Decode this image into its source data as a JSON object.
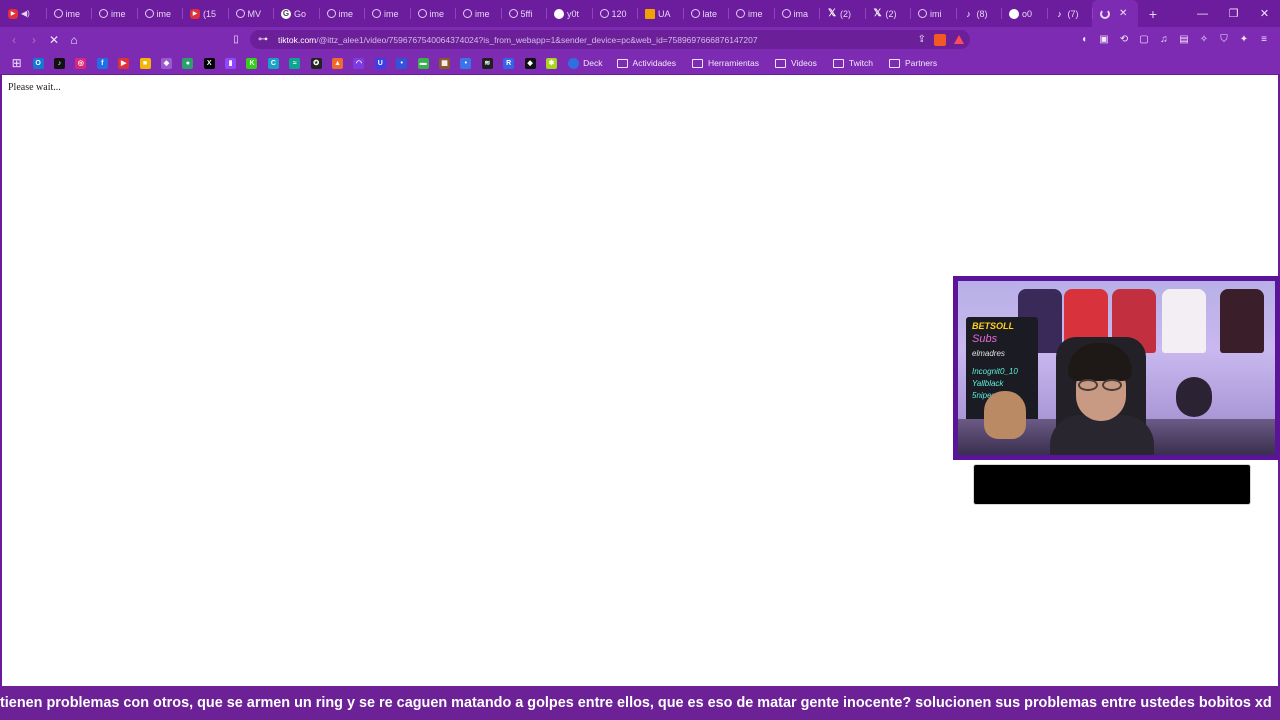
{
  "colors": {
    "frame": "#6c1d9e",
    "toolbar": "#7e2bb3",
    "omnibox": "#6b1f99",
    "content_bg": "#ffffff",
    "subtitle_bg": "#6d2196"
  },
  "tabs": [
    {
      "icon": "youtube-icon",
      "glyph": "▶",
      "style": "yt",
      "title": "",
      "audio": true
    },
    {
      "icon": "globe-icon",
      "glyph": "",
      "style": "globe",
      "title": "ime"
    },
    {
      "icon": "globe-icon",
      "glyph": "",
      "style": "globe",
      "title": "ime"
    },
    {
      "icon": "globe-icon",
      "glyph": "",
      "style": "globe",
      "title": "ime"
    },
    {
      "icon": "youtube-icon",
      "glyph": "▶",
      "style": "yt",
      "title": "(15"
    },
    {
      "icon": "globe-icon",
      "glyph": "",
      "style": "globe",
      "title": "MV"
    },
    {
      "icon": "google-icon",
      "glyph": "G",
      "style": "g",
      "title": "Go"
    },
    {
      "icon": "globe-icon",
      "glyph": "",
      "style": "globe",
      "title": "ime"
    },
    {
      "icon": "globe-icon",
      "glyph": "",
      "style": "globe",
      "title": "ime"
    },
    {
      "icon": "globe-icon",
      "glyph": "",
      "style": "globe",
      "title": "ime"
    },
    {
      "icon": "globe-icon",
      "glyph": "",
      "style": "globe",
      "title": "ime"
    },
    {
      "icon": "globe-icon",
      "glyph": "",
      "style": "globe",
      "title": "5ffi"
    },
    {
      "icon": "pill-icon",
      "glyph": "",
      "style": "pill",
      "title": "y0t"
    },
    {
      "icon": "globe-icon",
      "glyph": "",
      "style": "globe",
      "title": "120"
    },
    {
      "icon": "flag-icon",
      "glyph": "",
      "style": "flag",
      "title": "UA"
    },
    {
      "icon": "globe-icon",
      "glyph": "",
      "style": "globe",
      "title": "late"
    },
    {
      "icon": "globe-icon",
      "glyph": "",
      "style": "globe",
      "title": "ime"
    },
    {
      "icon": "globe-icon",
      "glyph": "",
      "style": "globe",
      "title": "ima"
    },
    {
      "icon": "x-icon",
      "glyph": "𝕏",
      "style": "x",
      "title": "(2)"
    },
    {
      "icon": "x-icon",
      "glyph": "𝕏",
      "style": "x",
      "title": "(2)"
    },
    {
      "icon": "globe-icon",
      "glyph": "",
      "style": "globe",
      "title": "imi"
    },
    {
      "icon": "tiktok-icon",
      "glyph": "♪",
      "style": "tt",
      "title": "(8)"
    },
    {
      "icon": "pill-icon",
      "glyph": "",
      "style": "pill",
      "title": "o0"
    },
    {
      "icon": "tiktok-icon",
      "glyph": "♪",
      "style": "tt",
      "title": "(7)"
    }
  ],
  "active_tab": {
    "icon": "loading-spinner-icon",
    "close_glyph": "✕"
  },
  "window_controls": {
    "minimize": "—",
    "restore": "❐",
    "close": "✕"
  },
  "toolbar": {
    "back": "‹",
    "forward": "›",
    "stop": "✕",
    "home": "⌂",
    "bookmark": "🔖",
    "site_info": "⊶",
    "url_host": "tiktok.com",
    "url_rest": "/@ittz_alee1/video/7596767540064374024?is_from_webapp=1&sender_device=pc&web_id=7589697666876147207",
    "share": "⇪"
  },
  "extensions": [
    {
      "name": "ext-1-icon",
      "glyph": "◖"
    },
    {
      "name": "ext-2-icon",
      "glyph": "▣"
    },
    {
      "name": "ext-3-icon",
      "glyph": "⟲"
    },
    {
      "name": "ext-4-icon",
      "glyph": "▢"
    },
    {
      "name": "music-icon",
      "glyph": "♫"
    },
    {
      "name": "sidebar-icon",
      "glyph": "▤"
    },
    {
      "name": "puzzle-icon",
      "glyph": "✧"
    },
    {
      "name": "vpn-icon",
      "glyph": "⛉"
    },
    {
      "name": "sparkle-icon",
      "glyph": "✦"
    },
    {
      "name": "menu-icon",
      "glyph": "≡"
    }
  ],
  "bookmarks": {
    "apps_glyph": "⊞",
    "icons": [
      {
        "name": "outlook-bookmark-icon",
        "color": "#1479d4",
        "glyph": "O"
      },
      {
        "name": "tiktok-bookmark-icon",
        "color": "#111111",
        "glyph": "♪"
      },
      {
        "name": "instagram-bookmark-icon",
        "color": "#d6297a",
        "glyph": "◎"
      },
      {
        "name": "facebook-bookmark-icon",
        "color": "#1f6fe5",
        "glyph": "f"
      },
      {
        "name": "youtube-bookmark-icon",
        "color": "#e0303a",
        "glyph": "▶"
      },
      {
        "name": "yellow-bookmark-icon",
        "color": "#f2b705",
        "glyph": "■"
      },
      {
        "name": "purple-bookmark-icon",
        "color": "#9c5ad1",
        "glyph": "◆"
      },
      {
        "name": "green-bookmark-icon",
        "color": "#2aa06b",
        "glyph": "●"
      },
      {
        "name": "x-bookmark-icon",
        "color": "#000000",
        "glyph": "X"
      },
      {
        "name": "twitch-bookmark-icon",
        "color": "#9146ff",
        "glyph": "▮"
      },
      {
        "name": "kick-bookmark-icon",
        "color": "#34d11b",
        "glyph": "K"
      },
      {
        "name": "cyan-bookmark-icon",
        "color": "#16a3c4",
        "glyph": "C"
      },
      {
        "name": "teal-bookmark-icon",
        "color": "#0ca58f",
        "glyph": "≈"
      },
      {
        "name": "gear-bookmark-icon",
        "color": "#222222",
        "glyph": "✪"
      },
      {
        "name": "orange-bookmark-icon",
        "color": "#f06a2c",
        "glyph": "▲"
      },
      {
        "name": "violet-bookmark-icon",
        "color": "#7d3ae0",
        "glyph": "◠"
      },
      {
        "name": "blue-bookmark-icon",
        "color": "#3a3fe6",
        "glyph": "U"
      },
      {
        "name": "indigo-bookmark-icon",
        "color": "#3354d6",
        "glyph": "•"
      },
      {
        "name": "chat-bookmark-icon",
        "color": "#38b24a",
        "glyph": "▬"
      },
      {
        "name": "brown-bookmark-icon",
        "color": "#8a5a2b",
        "glyph": "▦"
      },
      {
        "name": "dot-bookmark-icon",
        "color": "#3b73e8",
        "glyph": "•"
      },
      {
        "name": "music-bookmark-icon",
        "color": "#1f1f1f",
        "glyph": "≋"
      },
      {
        "name": "r-bookmark-icon",
        "color": "#3464e8",
        "glyph": "R"
      },
      {
        "name": "diamond-bookmark-icon",
        "color": "#111111",
        "glyph": "◆"
      },
      {
        "name": "lime-bookmark-icon",
        "color": "#a7d61c",
        "glyph": "✱"
      }
    ],
    "deck_label": "Deck",
    "folders": [
      {
        "label": "Actividades"
      },
      {
        "label": "Herramientas"
      },
      {
        "label": "Videos"
      },
      {
        "label": "Twitch"
      },
      {
        "label": "Partners"
      }
    ]
  },
  "page": {
    "status_text": "Please wait..."
  },
  "webcam": {
    "sponsor": "BETSOLL",
    "board_lines": [
      "Subs",
      "elmadres",
      "Incognit0_10",
      "Yallblack",
      "5niper"
    ]
  },
  "subtitle": {
    "text": "tienen problemas con otros, que se armen un ring y se re caguen matando a golpes entre ellos, que es eso de matar gente inocente? solucionen sus problemas entre ustedes bobitos xd"
  }
}
